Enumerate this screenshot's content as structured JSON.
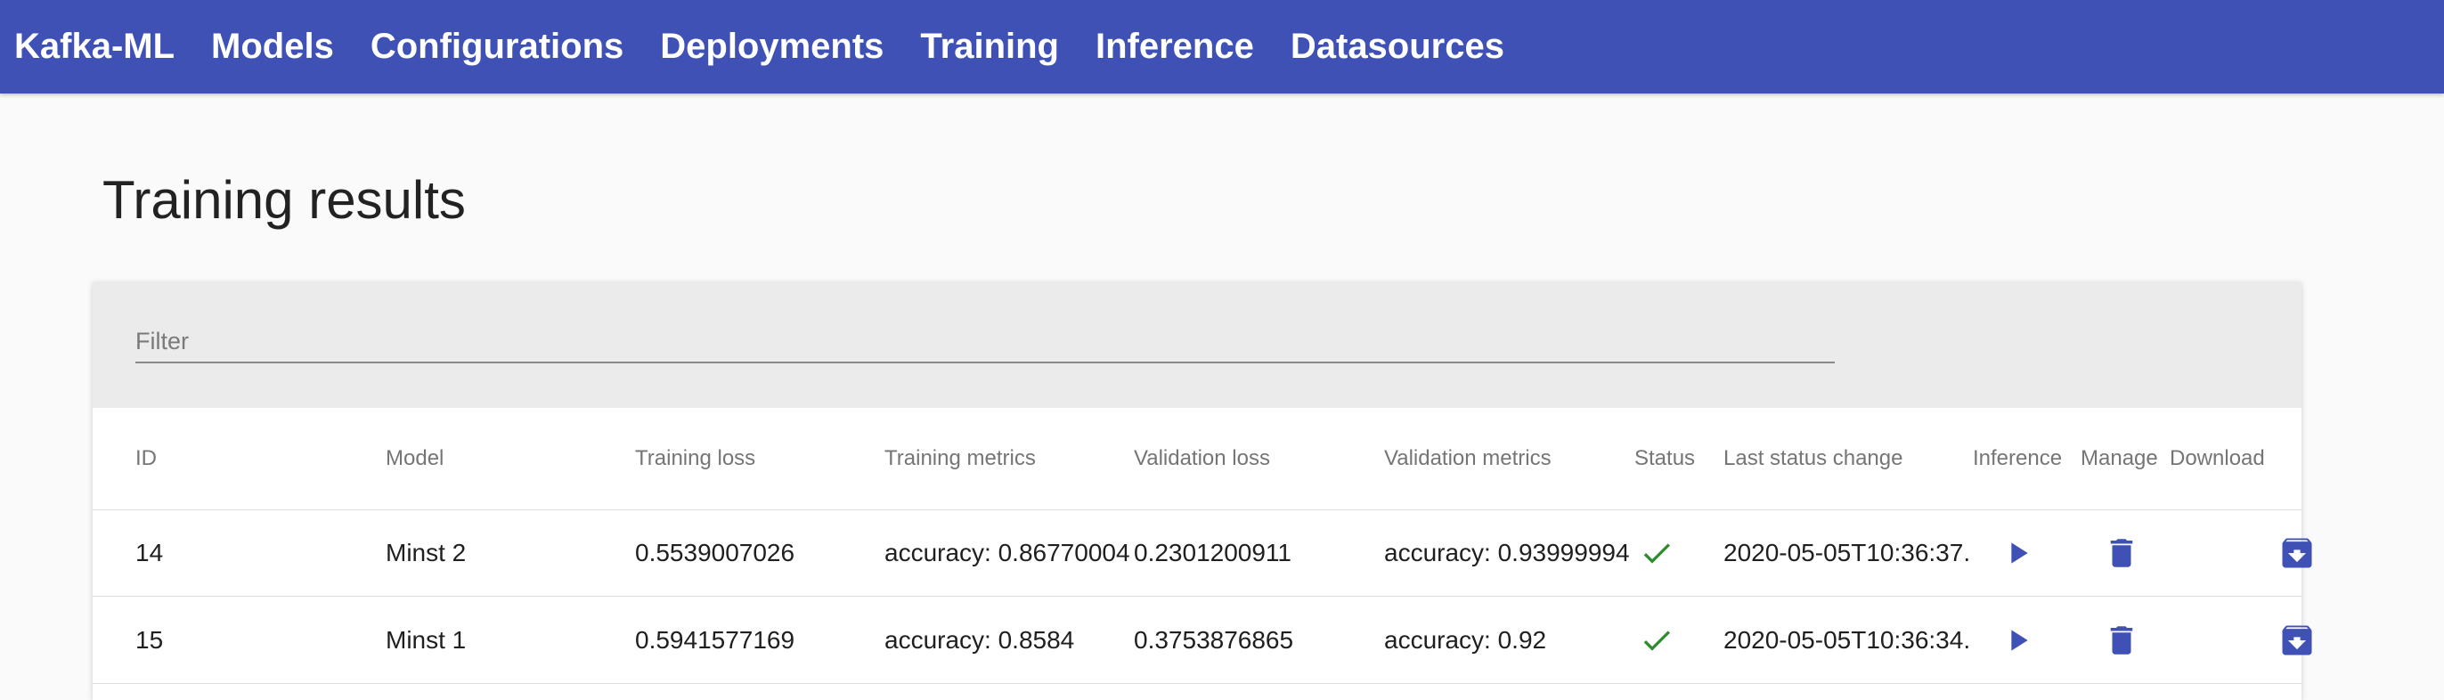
{
  "nav": {
    "brand": "Kafka-ML",
    "links": [
      "Models",
      "Configurations",
      "Deployments",
      "Training",
      "Inference",
      "Datasources"
    ]
  },
  "page": {
    "title": "Training results"
  },
  "filter": {
    "placeholder": "Filter",
    "value": ""
  },
  "colors": {
    "primary": "#3f51b5",
    "success": "#2e8b2e"
  },
  "table": {
    "headers": [
      "ID",
      "Model",
      "Training loss",
      "Training metrics",
      "Validation loss",
      "Validation metrics",
      "Status",
      "Last status change",
      "Inference",
      "Manage",
      "Download"
    ],
    "rows": [
      {
        "id": "14",
        "model": "Minst 2",
        "training_loss": "0.5539007026",
        "training_metrics": "accuracy: 0.86770004",
        "validation_loss": "0.2301200911",
        "validation_metrics": "accuracy: 0.93999994",
        "status_icon": "check-icon",
        "last_status_change": "2020-05-05T10:36:37.",
        "inference_icon": "play-icon",
        "manage_icon": "delete-icon",
        "download_icon": "archive-download-icon"
      },
      {
        "id": "15",
        "model": "Minst 1",
        "training_loss": "0.5941577169",
        "training_metrics": "accuracy: 0.8584",
        "validation_loss": "0.3753876865",
        "validation_metrics": "accuracy: 0.92",
        "status_icon": "check-icon",
        "last_status_change": "2020-05-05T10:36:34.",
        "inference_icon": "play-icon",
        "manage_icon": "delete-icon",
        "download_icon": "archive-download-icon"
      }
    ]
  }
}
